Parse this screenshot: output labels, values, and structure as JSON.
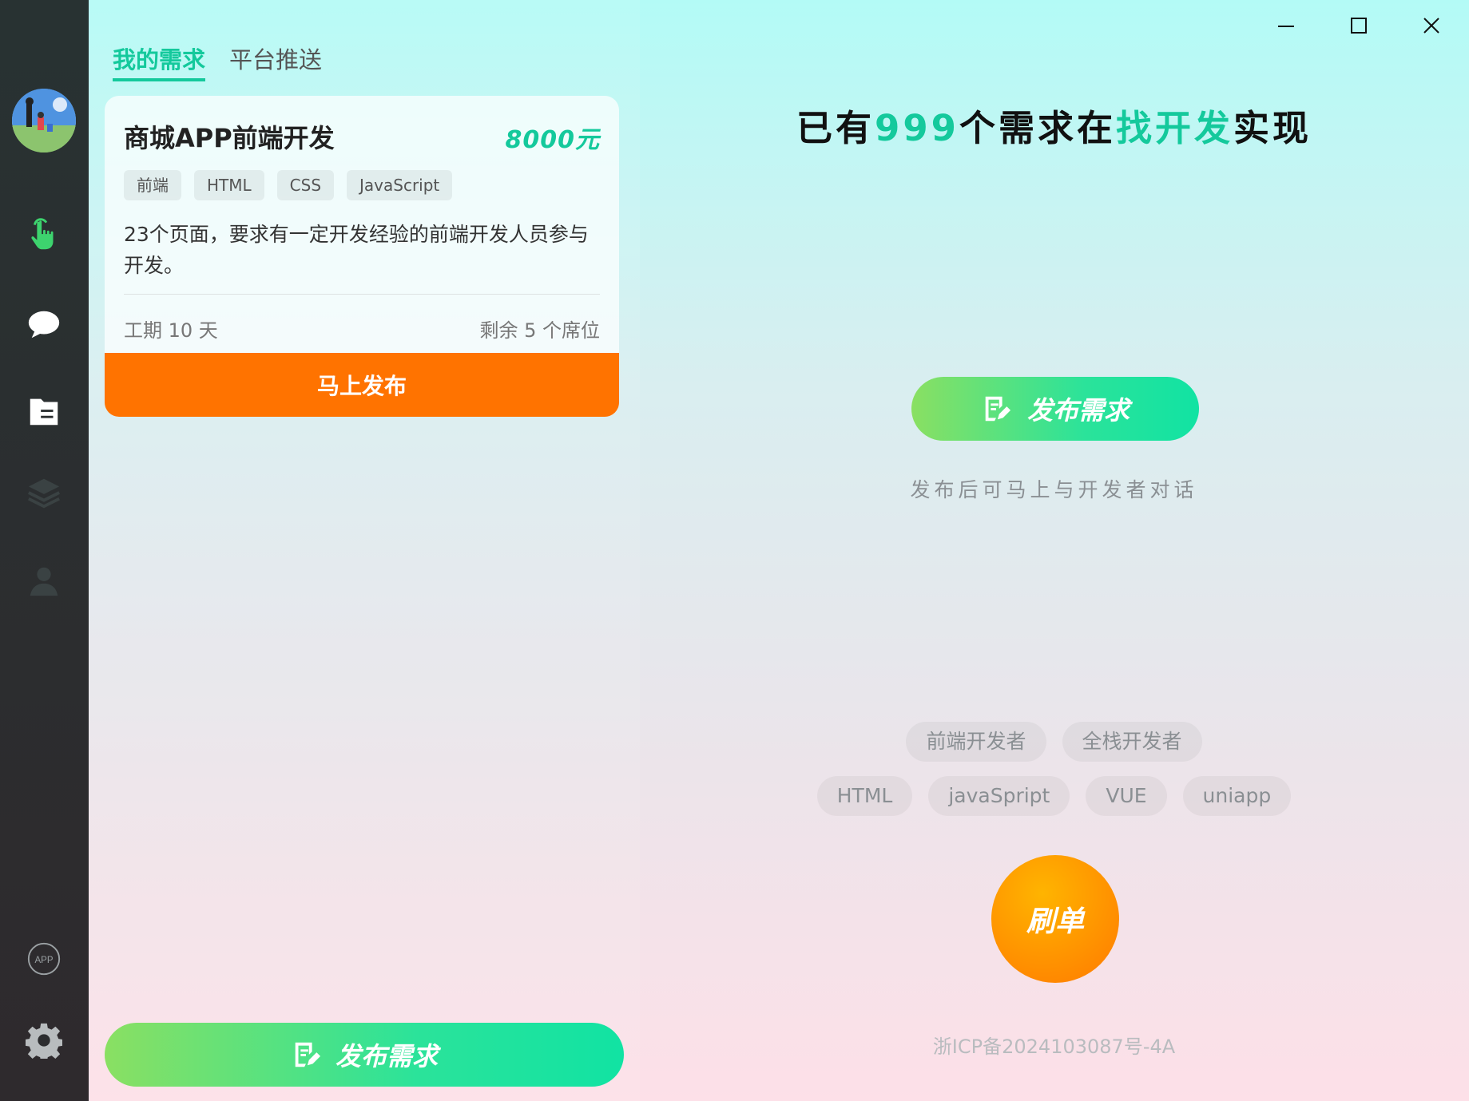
{
  "colors": {
    "accent": "#14c99c",
    "orange": "#ff7300",
    "sidebar": "#2b2f30"
  },
  "sidebar": {
    "items": [
      {
        "name": "hand-pointer-icon",
        "active": true
      },
      {
        "name": "chat-bubble-icon"
      },
      {
        "name": "document-icon"
      },
      {
        "name": "layers-icon"
      },
      {
        "name": "user-icon"
      },
      {
        "name": "app-icon",
        "label": "APP"
      },
      {
        "name": "gear-icon"
      }
    ]
  },
  "tabs": [
    {
      "label": "我的需求",
      "active": true
    },
    {
      "label": "平台推送",
      "active": false
    }
  ],
  "card": {
    "title": "商城APP前端开发",
    "price": "8000元",
    "tags": [
      "前端",
      "HTML",
      "CSS",
      "JavaScript"
    ],
    "description": "23个页面，要求有一定开发经验的前端开发人员参与开发。",
    "period": "工期 10 天",
    "seats": "剩余 5 个席位",
    "publish_label": "马上发布"
  },
  "bottom_button": {
    "label": "发布需求"
  },
  "headline": {
    "part1": "已有",
    "count": "999",
    "part2": "个需求在",
    "brand": "找开发",
    "part3": "实现"
  },
  "main_button": {
    "label": "发布需求"
  },
  "hint": "发布后可马上与开发者对话",
  "skills_row1": [
    "前端开发者",
    "全栈开发者"
  ],
  "skills_row2": [
    "HTML",
    "javaSpript",
    "VUE",
    "uniapp"
  ],
  "refresh_label": "刷单",
  "icp": "浙ICP备2024103087号-4A"
}
